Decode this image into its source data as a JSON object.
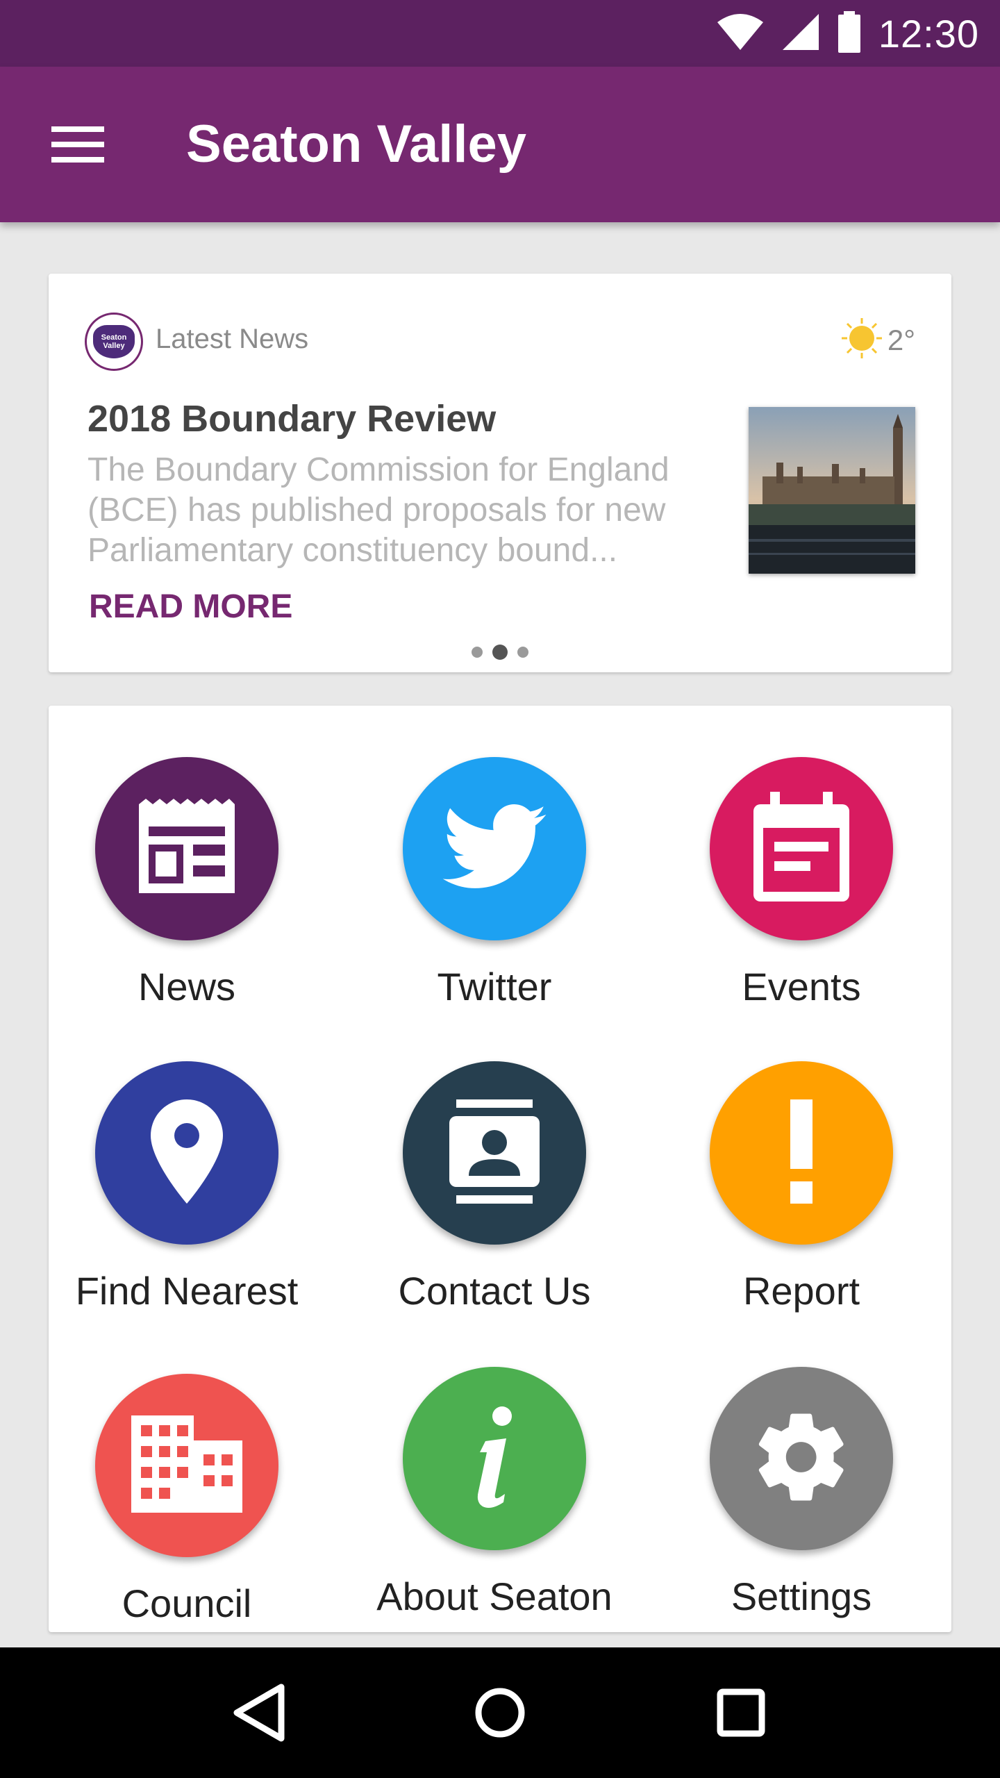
{
  "status_bar": {
    "time": "12:30"
  },
  "app_bar": {
    "title": "Seaton Valley",
    "color": "#762870"
  },
  "news": {
    "logo_text_1": "Seaton",
    "logo_text_2": "Valley",
    "source": "Latest News",
    "weather_temp": "2°",
    "headline": "2018 Boundary Review",
    "summary": "The Boundary Commission for England (BCE) has published proposals for new Parliamentary constituency bound...",
    "read_more": "READ MORE",
    "pager": {
      "count": 3,
      "active_index": 1
    }
  },
  "tiles": [
    {
      "label": "News",
      "color": "#5c2160",
      "icon": "newspaper-icon"
    },
    {
      "label": "Twitter",
      "color": "#1da1f2",
      "icon": "twitter-bird-icon"
    },
    {
      "label": "Events",
      "color": "#d81b60",
      "icon": "calendar-icon"
    },
    {
      "label": "Find Nearest",
      "color": "#303f9f",
      "icon": "location-pin-icon"
    },
    {
      "label": "Contact Us",
      "color": "#263f4f",
      "icon": "contacts-icon"
    },
    {
      "label": "Report",
      "color": "#ffa000",
      "icon": "exclamation-icon"
    },
    {
      "label": "Council",
      "color": "#ef5350",
      "icon": "building-icon"
    },
    {
      "label": "About Seaton",
      "color": "#4caf50",
      "icon": "info-icon"
    },
    {
      "label": "Settings",
      "color": "#808080",
      "icon": "gear-icon"
    }
  ]
}
